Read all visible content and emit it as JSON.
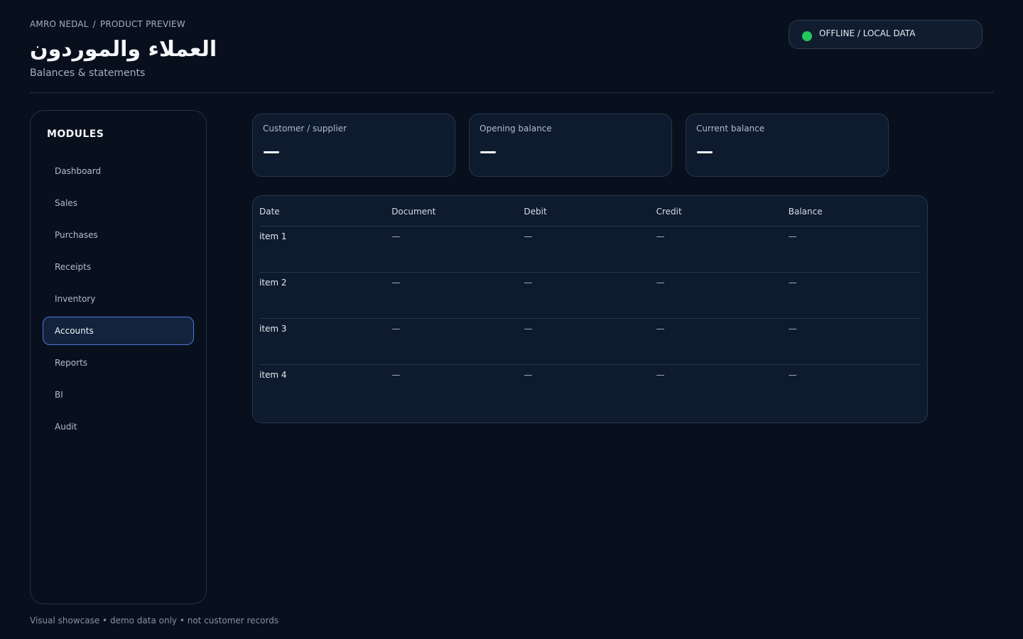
{
  "header": {
    "breadcrumb": {
      "owner": "AMRO NEDAL",
      "separator": "/",
      "section": "PRODUCT PREVIEW"
    },
    "title": "العملاء والموردون",
    "subtitle": "Balances & statements",
    "status": {
      "label": "OFFLINE / LOCAL DATA",
      "dot_color": "#22c55e"
    }
  },
  "sidebar": {
    "title": "MODULES",
    "items": [
      {
        "label": "Dashboard",
        "active": false
      },
      {
        "label": "Sales",
        "active": false
      },
      {
        "label": "Purchases",
        "active": false
      },
      {
        "label": "Receipts",
        "active": false
      },
      {
        "label": "Inventory",
        "active": false
      },
      {
        "label": "Accounts",
        "active": true
      },
      {
        "label": "Reports",
        "active": false
      },
      {
        "label": "BI",
        "active": false
      },
      {
        "label": "Audit",
        "active": false
      }
    ]
  },
  "cards": [
    {
      "label": "Customer / supplier",
      "value": "—"
    },
    {
      "label": "Opening balance",
      "value": "—"
    },
    {
      "label": "Current balance",
      "value": "—"
    }
  ],
  "ledger": {
    "columns": [
      "Date",
      "Document",
      "Debit",
      "Credit",
      "Balance"
    ],
    "rows": [
      [
        "item 1",
        "—",
        "—",
        "—",
        "—"
      ],
      [
        "item 2",
        "—",
        "—",
        "—",
        "—"
      ],
      [
        "item 3",
        "—",
        "—",
        "—",
        "—"
      ],
      [
        "item 4",
        "—",
        "—",
        "—",
        "—"
      ]
    ]
  },
  "footer": {
    "note": "Visual showcase • demo data only • not customer records"
  },
  "colors": {
    "accent": "#4f76d9",
    "background": "#08101d",
    "panel": "#0e1a2d"
  }
}
